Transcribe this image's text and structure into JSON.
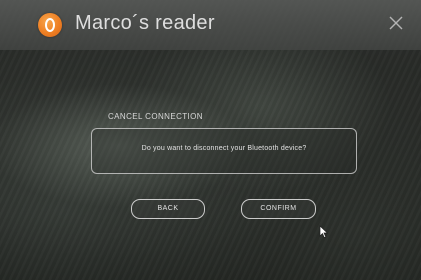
{
  "window": {
    "title": "Marco´s reader",
    "logo_icon": "app-logo-icon",
    "close_icon": "close-icon"
  },
  "dialog": {
    "heading": "CANCEL CONNECTION",
    "message": "Do you want to disconnect your Bluetooth device?",
    "buttons": {
      "back_label": "BACK",
      "confirm_label": "CONFIRM"
    }
  },
  "colors": {
    "logo_orange": "#ee7f23",
    "text_light": "#e2e2e2",
    "titlebar": "#5a5c5a"
  }
}
